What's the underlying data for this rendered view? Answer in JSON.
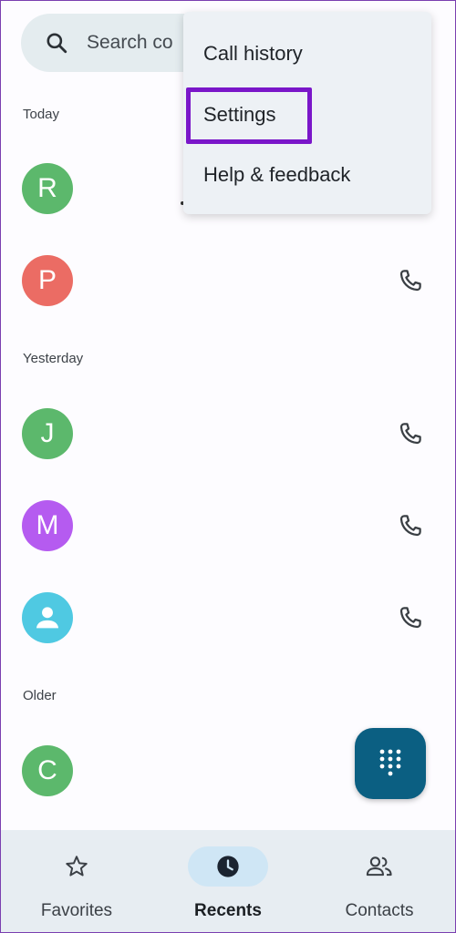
{
  "search": {
    "placeholder": "Search co",
    "icon": "search-icon"
  },
  "sections": {
    "today": "Today",
    "yesterday": "Yesterday",
    "older": "Older"
  },
  "contacts": [
    {
      "initial": "R",
      "color": "#5cb86c"
    },
    {
      "initial": "P",
      "color": "#eb6c64"
    },
    {
      "initial": "J",
      "color": "#5cb86c"
    },
    {
      "initial": "M",
      "color": "#b55bf0"
    },
    {
      "initial": "",
      "color": "#4fc9e2",
      "icon": "person-icon"
    },
    {
      "initial": "C",
      "color": "#5cb86c"
    }
  ],
  "menu": {
    "items": [
      "Call history",
      "Settings",
      "Help & feedback"
    ],
    "highlighted": "Settings",
    "highlight_color": "#7a16c9"
  },
  "fab": {
    "icon": "dialpad-icon",
    "color": "#0b5f82"
  },
  "nav": {
    "items": [
      {
        "label": "Favorites",
        "icon": "star-icon",
        "active": false
      },
      {
        "label": "Recents",
        "icon": "clock-icon",
        "active": true
      },
      {
        "label": "Contacts",
        "icon": "people-icon",
        "active": false
      }
    ]
  }
}
